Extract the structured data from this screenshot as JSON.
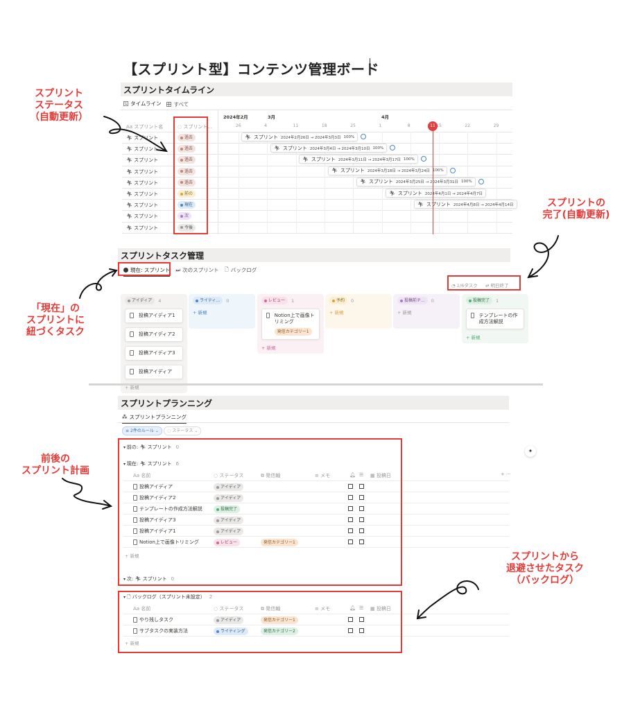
{
  "page": {
    "title": "【スプリント型】コンテンツ管理ボード"
  },
  "timeline": {
    "header": "スプリントタイムライン",
    "tabs": [
      {
        "label": "タイムライン"
      },
      {
        "label": "すべて"
      }
    ],
    "columns": {
      "name": "スプリント名",
      "status": "スプリント..."
    },
    "name_prefix": "Aa",
    "months": [
      "2024年2月",
      "3月",
      "4月"
    ],
    "days": [
      "26",
      "4",
      "11",
      "18",
      "25",
      "1",
      "8",
      "15",
      "22",
      "29"
    ],
    "today": "11",
    "row_name": "スプリント",
    "statuses": [
      "過去",
      "過去",
      "過去",
      "過去",
      "過去",
      "前の",
      "現在",
      "次",
      "今後"
    ],
    "bars": [
      {
        "name": "スプリント",
        "dates": "2024年2月26日 → 2024年3月3日",
        "pct": "100%"
      },
      {
        "name": "スプリント",
        "dates": "2024年3月4日 → 2024年3月10日",
        "pct": "100%"
      },
      {
        "name": "スプリント",
        "dates": "2024年3月11日 → 2024年3月17日",
        "pct": "100%"
      },
      {
        "name": "スプリント",
        "dates": "2024年3月18日 → 2024年3月24日",
        "pct": "100%"
      },
      {
        "name": "スプリント",
        "dates": "2024年3月25日 → 2024年3月31日",
        "pct": "100%"
      },
      {
        "name": "スプリント",
        "dates": "2024年4月1日 → 2024年4月7日",
        "pct": ""
      },
      {
        "name": "スプリント",
        "dates": "2024年4月8日 → 2024年4月14日",
        "pct": ""
      }
    ]
  },
  "tasks": {
    "header": "スプリントタスク管理",
    "tabs": [
      {
        "label": "現在: スプリント"
      },
      {
        "label": "次のスプリント"
      },
      {
        "label": "バックログ"
      }
    ],
    "actions": {
      "count": "1/6タスク",
      "complete": "明日終了"
    },
    "new_label": "+ 新規",
    "columns": [
      {
        "name": "アイディア",
        "count": "4",
        "cards": [
          "投稿アイディア1",
          "投稿アイディア2",
          "投稿アイディア3",
          "投稿アイディア"
        ]
      },
      {
        "name": "ライティ...",
        "count": "0",
        "cards": []
      },
      {
        "name": "レビュー",
        "count": "1",
        "cards": [
          "Notion上で画像トリミング"
        ],
        "tag": "発信カテゴリー1"
      },
      {
        "name": "予約",
        "count": "0",
        "cards": []
      },
      {
        "name": "投稿前チ...",
        "count": "0",
        "cards": []
      },
      {
        "name": "投稿完了",
        "count": "1",
        "cards": [
          "テンプレートの作成方法解説"
        ]
      }
    ]
  },
  "planning": {
    "header": "スプリントプランニング",
    "tab": "スプリントプランニング",
    "filters": {
      "rules": "2件のルール",
      "status": "ステータス"
    },
    "groups": {
      "prev": {
        "label": "前の:",
        "name": "スプリント",
        "count": "0"
      },
      "current": {
        "label": "現在:",
        "name": "スプリント",
        "count": "6"
      },
      "next": {
        "label": "次:",
        "name": "スプリント",
        "count": "0"
      },
      "backlog": {
        "label": "バックログ（スプリント未設定）",
        "count": "2"
      }
    },
    "columns": {
      "name": "名前",
      "status": "ステータス",
      "axis": "発信軸",
      "memo": "メモ",
      "date": "投稿日"
    },
    "new_label": "+ 新規",
    "current_rows": [
      {
        "name": "投稿アイディア",
        "status": "アイディア",
        "tag": ""
      },
      {
        "name": "投稿アイディア2",
        "status": "アイディア",
        "tag": ""
      },
      {
        "name": "テンプレートの作成方法解説",
        "status": "投稿完了",
        "tag": ""
      },
      {
        "name": "投稿アイディア3",
        "status": "アイディア",
        "tag": ""
      },
      {
        "name": "投稿アイディア1",
        "status": "アイディア",
        "tag": ""
      },
      {
        "name": "Notion上で画像トリミング",
        "status": "レビュー",
        "tag": "発信カテゴリー1"
      }
    ],
    "backlog_rows": [
      {
        "name": "やり残しタスク",
        "status": "アイディア",
        "tag": "発信カテゴリー1"
      },
      {
        "name": "サブタスクの実装方法",
        "status": "ライティング",
        "tag": "発信カテゴリー2"
      }
    ]
  },
  "annotations": {
    "sprint_status": "スプリント\nステータス\n（自動更新）",
    "sprint_complete": "スプリントの\n完了(自動更新)",
    "current_tasks": "「現在」の\nスプリントに\n紐づくタスク",
    "before_after": "前後の\nスプリント計画",
    "backlog": "スプリントから\n退避させたタスク\n（バックログ）"
  },
  "colors": {
    "accent": "#e53935",
    "today": "#e03e3e",
    "ring": "#4a86c8"
  }
}
